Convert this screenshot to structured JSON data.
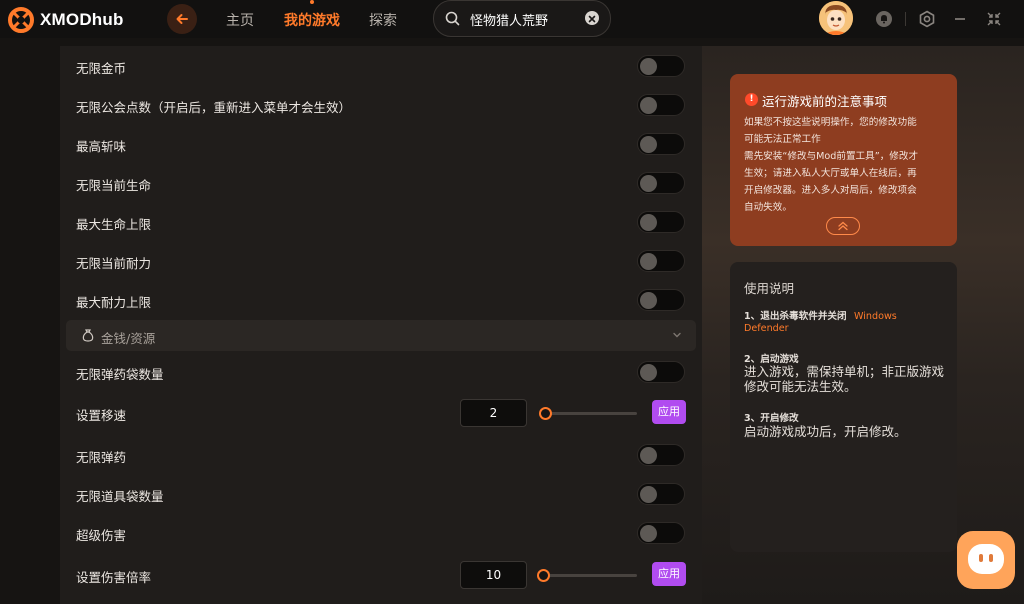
{
  "app": {
    "name": "XMODhub",
    "brand_color": "#ff7a2a",
    "accent_purple": "#b14cf0"
  },
  "nav": {
    "home": "主页",
    "my_games": "我的游戏",
    "explore": "探索",
    "active": "my_games"
  },
  "search": {
    "value": "怪物猎人荒野",
    "clear_icon": "close-icon"
  },
  "settings": {
    "rows_top": [
      {
        "label": "无限金币",
        "on": false
      },
      {
        "label": "无限公会点数（开启后，重新进入菜单才会生效）",
        "on": false
      },
      {
        "label": "最高斩味",
        "on": false
      },
      {
        "label": "无限当前生命",
        "on": false
      },
      {
        "label": "最大生命上限",
        "on": false
      },
      {
        "label": "无限当前耐力",
        "on": false
      },
      {
        "label": "最大耐力上限",
        "on": false
      }
    ],
    "section": {
      "label": "金钱/资源",
      "icon": "money-bag-icon"
    },
    "ammo_row": {
      "label": "无限弹药袋数量",
      "on": false
    },
    "speed_row": {
      "label": "设置移速",
      "value": "2",
      "slider_fraction": 0.05,
      "apply_label": "应用"
    },
    "rows_mid": [
      {
        "label": "无限弹药",
        "on": false
      },
      {
        "label": "无限道具袋数量",
        "on": false
      },
      {
        "label": "超级伤害",
        "on": false
      }
    ],
    "damage_row": {
      "label": "设置伤害倍率",
      "value": "10",
      "slider_fraction": 0.03,
      "apply_label": "应用"
    }
  },
  "notice": {
    "title": "运行游戏前的注意事项",
    "lines": [
      "如果您不按这些说明操作，您的修改功能",
      "可能无法正常工作",
      "需先安装“修改与Mod前置工具”，修改才",
      "生效；请进入私人大厅或单人在线后，再",
      "开启修改器。进入多人对局后，修改项会",
      "自动失效。"
    ]
  },
  "guide": {
    "title": "使用说明",
    "step1_title": "1、退出杀毒软件并关闭",
    "step1_link": "Windows",
    "step1_link_2": "Defender",
    "step2_title": "2、启动游戏",
    "step2_desc": "进入游戏，需保持单机；非正版游戏修改可能无法生效。",
    "step3_title": "3、开启修改",
    "step3_desc": "启动游戏成功后，开启修改。"
  }
}
